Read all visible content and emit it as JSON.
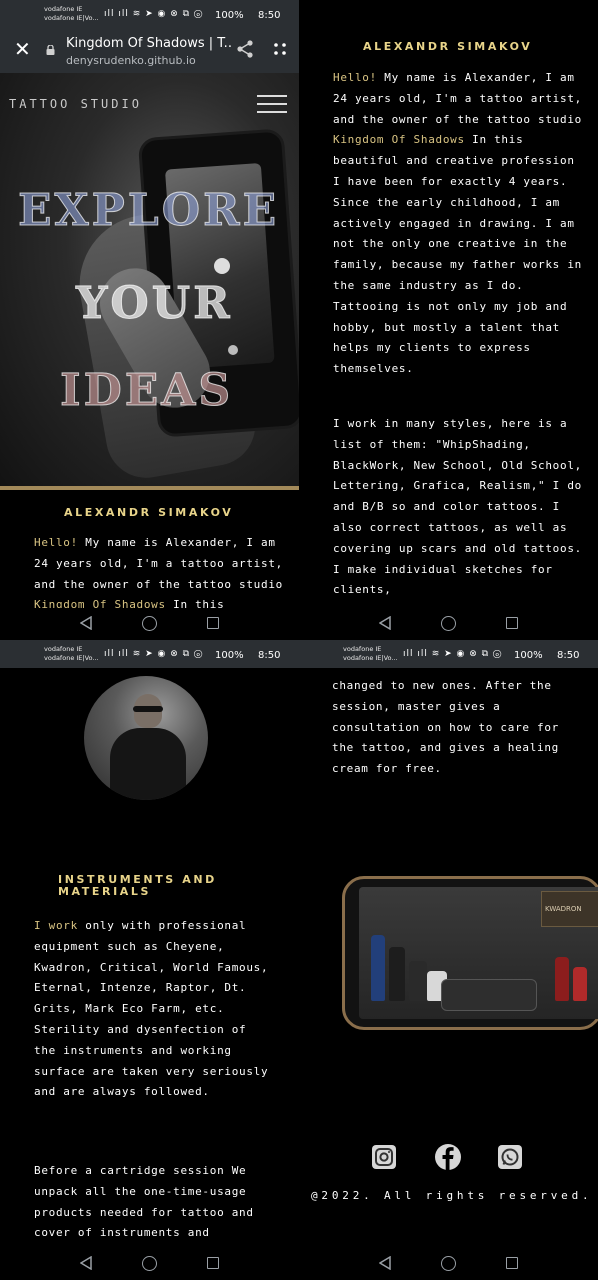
{
  "status": {
    "carrier_lines": [
      "vodafone IE",
      "vodafone IE|Vo..."
    ],
    "carrier_lines_1": [
      "vodafone IE",
      "vodafone IE|Vo..."
    ],
    "signal_icons": "ıll ıll ≋ ➤ ◉ ⊗ ⧉ ⓞ",
    "battery": "100%",
    "time": "8:50"
  },
  "browser": {
    "title": "Kingdom Of Shadows | T...",
    "url": "denysrudenko.github.io"
  },
  "hero": {
    "studio": "TATTOO STUDIO",
    "word1": "EXPLORE",
    "word2": "YOUR",
    "word3": "IDEAS"
  },
  "about": {
    "name": "ALEXANDR SIMAKOV",
    "hello": "Hello!",
    "intro_a": " My name is Alexander, I am 24 years old, I'm a tattoo artist, and the owner of the tattoo studio ",
    "studio_name": "Kingdom Of Shadows",
    "intro_b": " In this beautiful and creative profession I have been for exactly 4 years. Since the early childhood, I am actively engaged in drawing. I am not the only one creative in the family, because my father works in the same industry as I do. Tattooing is not only my job and hobby, but mostly a talent that helps my clients to express themselves.",
    "styles_paragraph": "I work in many styles, here is a list of them: \"WhipShading, BlackWork, New School, Old School, Lettering, Grafica, Realism,\" I do and B/B so and color tattoos. I also correct tattoos, as well as covering up scars and old tattoos. I make individual sketches for clients,"
  },
  "instruments": {
    "heading": "INSTRUMENTS AND MATERIALS",
    "i_work": "I work",
    "equipment": " only with professional equipment such as Cheyene, Kwadron, Critical, World Famous, Eternal, Intenze, Raptor, Dt. Grits, Mark Eco Farm, etc. Sterility and dysenfection of the instruments and working surface are taken very seriously and are always followed.",
    "cartridge": "Before a cartridge session We unpack all the one-time-usage products needed for tattoo and cover of instruments and",
    "aftercare": "changed to new ones. After the session, master gives a consultation on how to care for the tattoo, and gives a healing cream for free.",
    "box_label": "KWADRON"
  },
  "footer": {
    "copyright": "@2022. All rights reserved.",
    "social_icons": [
      "instagram-icon",
      "facebook-icon",
      "whatsapp-icon"
    ]
  },
  "colors": {
    "gold": "#d9c483",
    "bar": "#2b2f33",
    "bg": "#000000"
  }
}
